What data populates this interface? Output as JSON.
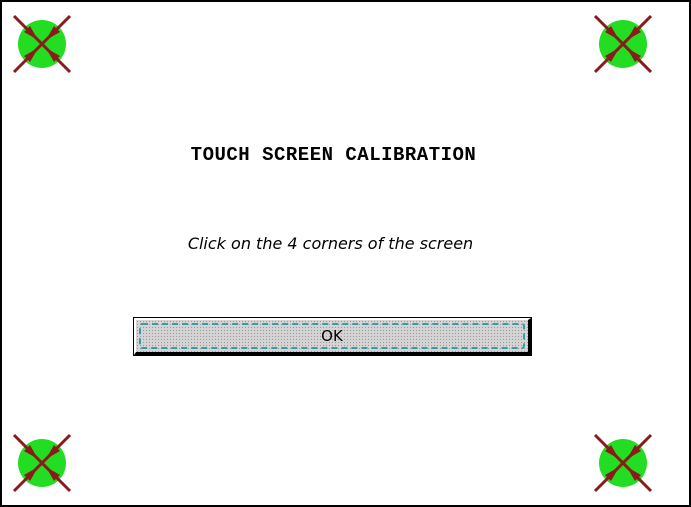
{
  "dialog": {
    "title": "TOUCH SCREEN CALIBRATION",
    "instruction": "Click on the 4 corners of the screen",
    "ok_label": "OK"
  },
  "targets": [
    {
      "corner": "top-left",
      "icon": "calibration-target-icon"
    },
    {
      "corner": "top-right",
      "icon": "calibration-target-icon"
    },
    {
      "corner": "bottom-left",
      "icon": "calibration-target-icon"
    },
    {
      "corner": "bottom-right",
      "icon": "calibration-target-icon"
    }
  ],
  "colors": {
    "target_fill": "#22dd22",
    "target_arrows": "#8b1a1a",
    "focus_dash": "#3a9aa5",
    "button_face": "#d4d4d4"
  }
}
